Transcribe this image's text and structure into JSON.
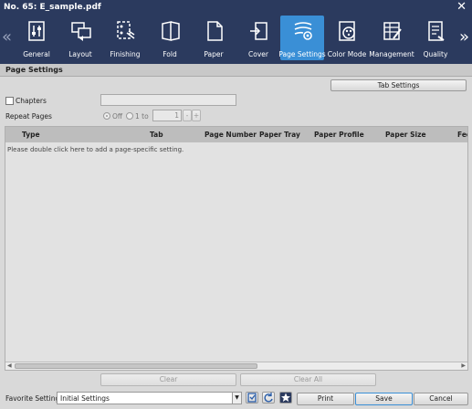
{
  "window": {
    "title": "No. 65: E_sample.pdf"
  },
  "toolbar": {
    "tabs": [
      {
        "label": "General",
        "icon": "general-icon"
      },
      {
        "label": "Layout",
        "icon": "layout-icon"
      },
      {
        "label": "Finishing",
        "icon": "finishing-icon"
      },
      {
        "label": "Fold",
        "icon": "fold-icon"
      },
      {
        "label": "Paper",
        "icon": "paper-icon"
      },
      {
        "label": "Cover",
        "icon": "cover-icon"
      },
      {
        "label": "Page Settings",
        "icon": "page-settings-icon",
        "active": true
      },
      {
        "label": "Color Mode",
        "icon": "color-mode-icon"
      },
      {
        "label": "Management",
        "icon": "management-icon"
      },
      {
        "label": "Quality",
        "icon": "quality-icon"
      }
    ]
  },
  "page_settings": {
    "heading": "Page Settings",
    "tab_settings_button": "Tab Settings",
    "chapters_label": "Chapters",
    "chapters_value": "",
    "repeat_pages_label": "Repeat Pages",
    "off_label": "Off",
    "one_to_label": "1 to",
    "repeat_value": "1",
    "minus_label": "-",
    "plus_label": "+"
  },
  "grid": {
    "columns": [
      "Type",
      "Tab",
      "Page Number",
      "Paper Tray",
      "Paper Profile",
      "Paper Size",
      "Fee"
    ],
    "placeholder": "Please double click here to add a page-specific setting."
  },
  "actions": {
    "clear": "Clear",
    "clear_all": "Clear All"
  },
  "footer": {
    "favorite_label": "Favorite Setting",
    "favorite_value": "Initial Settings",
    "print": "Print",
    "save": "Save",
    "cancel": "Cancel"
  },
  "colors": {
    "titlebar": "#2b3a5e",
    "active_tab": "#3a8fd6"
  }
}
